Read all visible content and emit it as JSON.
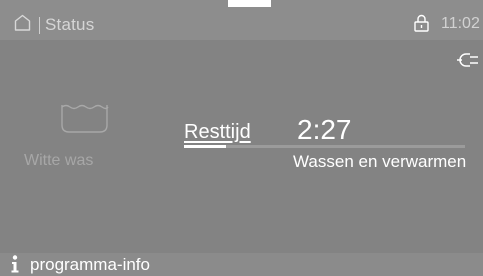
{
  "header": {
    "title": "Status",
    "time": "11:02",
    "icons": [
      "home-icon",
      "lock-icon"
    ]
  },
  "program": {
    "name": "Witte was",
    "icon": "washing-tub-icon"
  },
  "status": {
    "remaining_label": "Resttijd",
    "remaining_time": "2:27",
    "progress_fraction": 0.15,
    "phase": "Wassen en verwarmen",
    "power_icon": "plug-icon"
  },
  "footer": {
    "info_label": "programma-info",
    "info_icon": "info-icon"
  },
  "colors": {
    "screen_background": "#838383",
    "text_primary": "#ffffff",
    "text_dimmed": "#a7a7a7"
  }
}
